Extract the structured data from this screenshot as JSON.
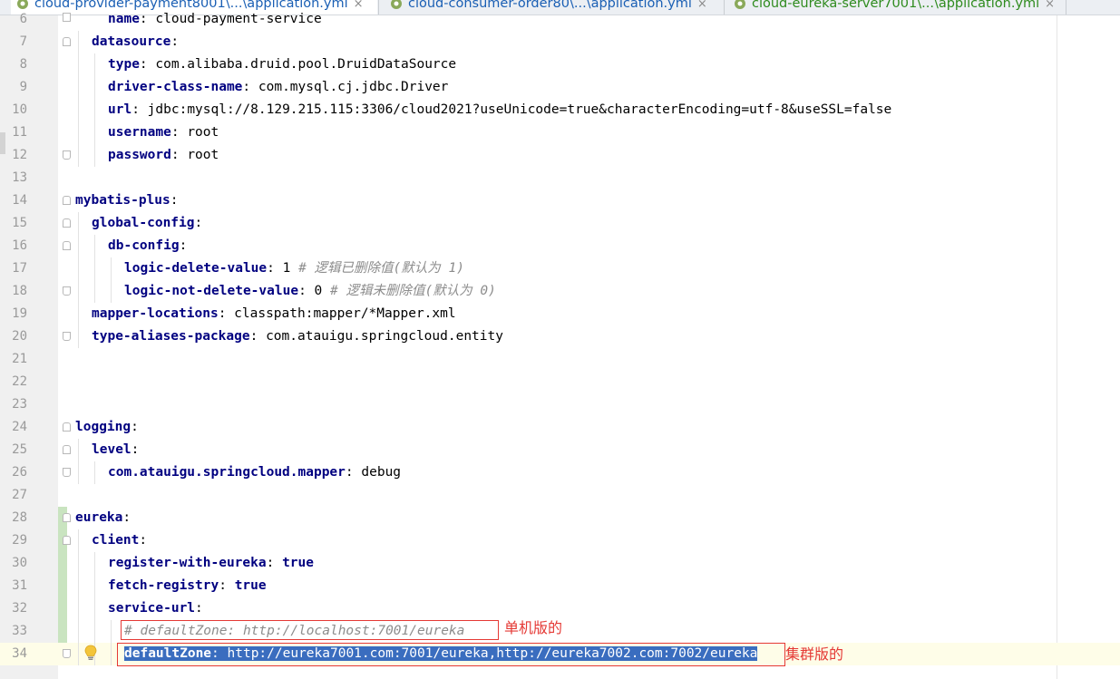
{
  "tabs": [
    {
      "title": "cloud-provider-payment8001\\...\\application.yml",
      "close": "×",
      "icon": "yaml-file-icon",
      "active": true
    },
    {
      "title": "cloud-consumer-order80\\...\\application.yml",
      "close": "×",
      "icon": "yaml-file-icon",
      "active": false
    },
    {
      "title": "cloud-eureka-server7001\\...\\application.yml",
      "close": "×",
      "icon": "yaml-file-icon",
      "active": false
    }
  ],
  "editor": {
    "current_line": 34,
    "lines": [
      {
        "n": "6",
        "key": "name",
        "value": "cloud-payment-service"
      },
      {
        "n": "7",
        "key": "datasource",
        "value": ""
      },
      {
        "n": "8",
        "key": "type",
        "value": "com.alibaba.druid.pool.DruidDataSource"
      },
      {
        "n": "9",
        "key": "driver-class-name",
        "value": "com.mysql.cj.jdbc.Driver"
      },
      {
        "n": "10",
        "key": "url",
        "value": "jdbc:mysql://8.129.215.115:3306/cloud2021?useUnicode=true&characterEncoding=utf-8&useSSL=false"
      },
      {
        "n": "11",
        "key": "username",
        "value": "root"
      },
      {
        "n": "12",
        "key": "password",
        "value": "root"
      },
      {
        "n": "13"
      },
      {
        "n": "14",
        "key": "mybatis-plus",
        "value": ""
      },
      {
        "n": "15",
        "key": "global-config",
        "value": ""
      },
      {
        "n": "16",
        "key": "db-config",
        "value": ""
      },
      {
        "n": "17",
        "key": "logic-delete-value",
        "value": "1",
        "comment": "# 逻辑已删除值(默认为 1)"
      },
      {
        "n": "18",
        "key": "logic-not-delete-value",
        "value": "0",
        "comment": "# 逻辑未删除值(默认为 0)"
      },
      {
        "n": "19",
        "key": "mapper-locations",
        "value": "classpath:mapper/*Mapper.xml"
      },
      {
        "n": "20",
        "key": "type-aliases-package",
        "value": "com.atauigu.springcloud.entity"
      },
      {
        "n": "21"
      },
      {
        "n": "22"
      },
      {
        "n": "23"
      },
      {
        "n": "24",
        "key": "logging",
        "value": ""
      },
      {
        "n": "25",
        "key": "level",
        "value": ""
      },
      {
        "n": "26",
        "key": "com.atauigu.springcloud.mapper",
        "value": "debug"
      },
      {
        "n": "27"
      },
      {
        "n": "28",
        "key": "eureka",
        "value": ""
      },
      {
        "n": "29",
        "key": "client",
        "value": ""
      },
      {
        "n": "30",
        "key": "register-with-eureka",
        "value": "true"
      },
      {
        "n": "31",
        "key": "fetch-registry",
        "value": "true"
      },
      {
        "n": "32",
        "key": "service-url",
        "value": ""
      },
      {
        "n": "33",
        "comment": "# defaultZone: http://localhost:7001/eureka"
      },
      {
        "n": "34",
        "key": "defaultZone",
        "value": "http://eureka7001.com:7001/eureka,http://eureka7002.com:7002/eureka"
      }
    ]
  },
  "annotations": {
    "standalone": "单机版的",
    "cluster": "集群版的"
  },
  "colors": {
    "key": "#000080",
    "comment": "#8c8c8c",
    "selection": "#3a6dbf",
    "annotation": "#e53935",
    "current_line": "#fefde8"
  },
  "icons": {
    "intention": "lightbulb-icon"
  }
}
